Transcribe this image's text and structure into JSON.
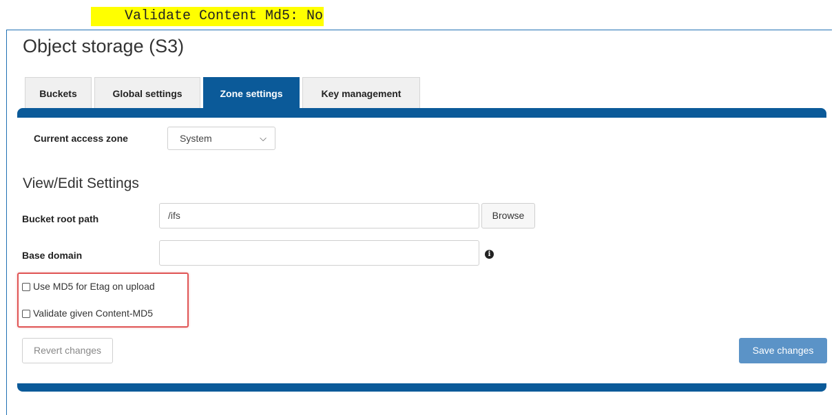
{
  "snippet": "    Validate Content Md5: No",
  "page_title": "Object storage (S3)",
  "tabs": [
    {
      "label": "Buckets",
      "active": false
    },
    {
      "label": "Global settings",
      "active": false
    },
    {
      "label": "Zone settings",
      "active": true
    },
    {
      "label": "Key management",
      "active": false
    }
  ],
  "zone": {
    "label": "Current access zone",
    "selected": "System"
  },
  "section_title": "View/Edit Settings",
  "fields": {
    "bucket_root_path": {
      "label": "Bucket root path",
      "value": "/ifs",
      "browse_label": "Browse"
    },
    "base_domain": {
      "label": "Base domain",
      "value": "",
      "info_icon": "info-icon"
    }
  },
  "checkboxes": [
    {
      "label": "Use MD5 for Etag on upload",
      "checked": false
    },
    {
      "label": "Validate given Content-MD5",
      "checked": false
    }
  ],
  "buttons": {
    "revert": "Revert changes",
    "save": "Save changes"
  },
  "colors": {
    "accent": "#0b5a99",
    "save_button": "#5b93c7",
    "highlight_box": "#e05555",
    "snippet_bg": "#ffff00"
  }
}
